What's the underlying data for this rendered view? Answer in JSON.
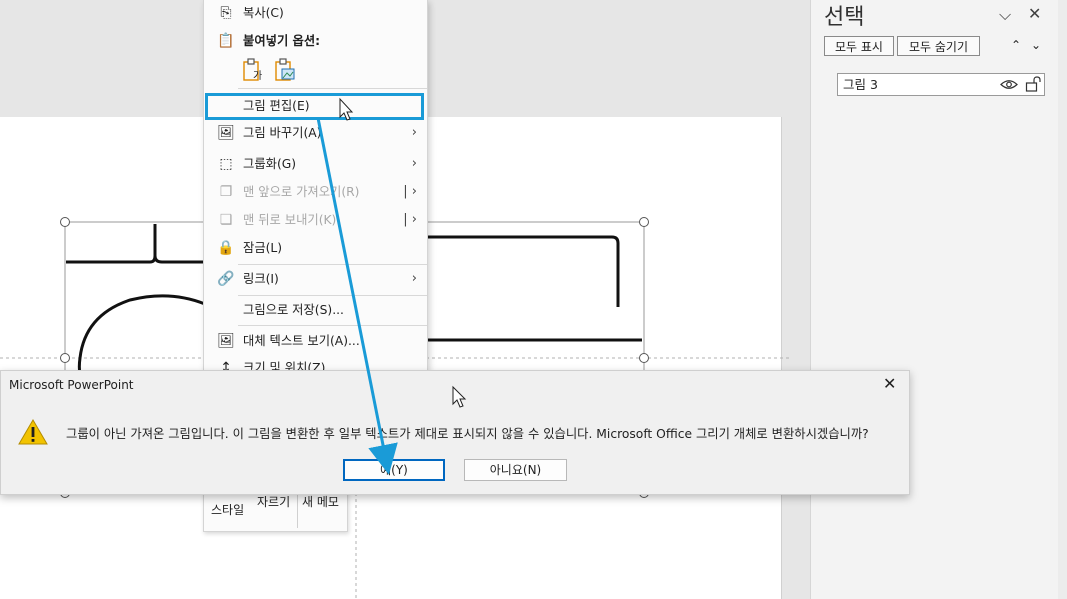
{
  "menu": {
    "copy": "복사(C)",
    "paste_options": "붙여넣기 옵션:",
    "paste_icon_text": "가",
    "items": [
      {
        "label": "그림 편집(E)",
        "icon": "edit-picture-icon",
        "has_submenu": false,
        "enabled": true
      },
      {
        "label": "그림 바꾸기(A)",
        "icon": "change-picture-icon",
        "has_submenu": true,
        "enabled": true
      },
      {
        "label": "그룹화(G)",
        "icon": "group-icon",
        "has_submenu": true,
        "enabled": true
      },
      {
        "label": "맨 앞으로 가져오기(R)",
        "icon": "bring-to-front-icon",
        "has_submenu": true,
        "enabled": false
      },
      {
        "label": "맨 뒤로 보내기(K)",
        "icon": "send-to-back-icon",
        "has_submenu": true,
        "enabled": false
      },
      {
        "label": "잠금(L)",
        "icon": "lock-icon",
        "has_submenu": false,
        "enabled": true
      },
      {
        "label": "링크(I)",
        "icon": "link-icon",
        "has_submenu": true,
        "enabled": true
      },
      {
        "label": "그림으로 저장(S)...",
        "icon": "",
        "has_submenu": false,
        "enabled": true
      },
      {
        "label": "대체 텍스트 보기(A)...",
        "icon": "alt-text-icon",
        "has_submenu": false,
        "enabled": true
      },
      {
        "label": "크기 및 위치(Z)...",
        "icon": "size-position-icon",
        "has_submenu": false,
        "enabled": true
      }
    ]
  },
  "minibar": {
    "style": "스타일",
    "crop": "자르기",
    "new_comment": "새 메모"
  },
  "selection_pane": {
    "title": "선택",
    "show_all": "모두 표시",
    "hide_all": "모두 숨기기",
    "item": "그림 3"
  },
  "dialog": {
    "title": "Microsoft PowerPoint",
    "message": "그룹이 아닌 가져온 그림입니다. 이 그림을 변환한 후 일부 텍스트가 제대로 표시되지 않을 수 있습니다. Microsoft Office 그리기 개체로 변환하시겠습니까?",
    "yes": "예(Y)",
    "no": "아니요(N)"
  },
  "colors": {
    "highlight": "#1a9bd7",
    "accent": "#0067c0",
    "warning": "#f2c300"
  }
}
